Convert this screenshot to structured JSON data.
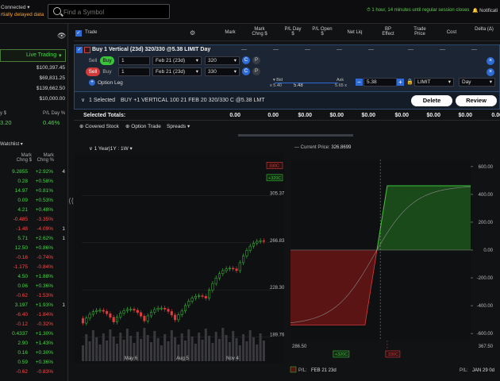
{
  "topbar": {
    "status": "Connected",
    "delayed": "rtially delayed data",
    "search_placeholder": "Find a Symbol",
    "session": "1 hour, 14 minutes until regular session closes",
    "notifications": "Notificati"
  },
  "left": {
    "live_trading": "Live Trading",
    "balances": [
      "$100,397.45",
      "$69,831.25",
      "$139,662.50",
      "$10,000.00"
    ],
    "pl_day_label": "y $",
    "pl_day_value": "3.20",
    "pl_pct_label": "P/L Day %",
    "pl_pct_value": "0.46%",
    "watchlist_label": "Watchlist",
    "col1": "Mark Chng $",
    "col2": "Mark Chng %",
    "rows": [
      {
        "a": "9.2855",
        "b": "+2.92%",
        "c": "green",
        "extra": "4"
      },
      {
        "a": "0.28",
        "b": "+0.58%",
        "c": "green"
      },
      {
        "a": "14.97",
        "b": "+0.81%",
        "c": "green"
      },
      {
        "a": "0.09",
        "b": "+0.53%",
        "c": "green"
      },
      {
        "a": "4.21",
        "b": "+0.48%",
        "c": "green"
      },
      {
        "a": "-0.485",
        "b": "-3.35%",
        "c": "red"
      },
      {
        "a": "-1.48",
        "b": "-4.09%",
        "c": "red",
        "extra": "1"
      },
      {
        "a": "5.71",
        "b": "+2.62%",
        "c": "green",
        "extra": "1"
      },
      {
        "a": "12.50",
        "b": "+0.86%",
        "c": "green"
      },
      {
        "a": "-0.16",
        "b": "-0.74%",
        "c": "red"
      },
      {
        "a": "-1.175",
        "b": "-0.84%",
        "c": "red"
      },
      {
        "a": "4.50",
        "b": "+1.88%",
        "c": "green"
      },
      {
        "a": "0.06",
        "b": "+0.36%",
        "c": "green"
      },
      {
        "a": "-0.62",
        "b": "-1.53%",
        "c": "red"
      },
      {
        "a": "3.197",
        "b": "+1.93%",
        "c": "green",
        "extra": "1"
      },
      {
        "a": "-6.40",
        "b": "-1.84%",
        "c": "red"
      },
      {
        "a": "-0.12",
        "b": "-0.32%",
        "c": "red"
      },
      {
        "a": "0.4337",
        "b": "+1.30%",
        "c": "green"
      },
      {
        "a": "2.90",
        "b": "+1.43%",
        "c": "green"
      },
      {
        "a": "0.16",
        "b": "+0.30%",
        "c": "green"
      },
      {
        "a": "0.59",
        "b": "+0.36%",
        "c": "green"
      },
      {
        "a": "-0.62",
        "b": "-0.83%",
        "c": "red"
      }
    ]
  },
  "table": {
    "headers": [
      "Trade",
      "Mark",
      "Mark Chng $",
      "P/L Day $",
      "P/L Open $",
      "Net Liq",
      "BP Effect",
      "Trade Price",
      "Cost",
      "Delta (Δ)"
    ],
    "order_title": "Buy 1 Vertical (23d) 320/330 @5.38 LIMIT Day",
    "legs": [
      {
        "sell": "Sell",
        "buy": "Buy",
        "active": "buy",
        "qty": "1",
        "exp": "Feb 21 (23d)",
        "strike": "320"
      },
      {
        "sell": "Sell",
        "buy": "Buy",
        "active": "sell",
        "qty": "1",
        "exp": "Feb 21 (23d)",
        "strike": "330"
      }
    ],
    "call_label": "C",
    "put_label": "P",
    "option_leg": "Option Leg",
    "bid_label": "Bid",
    "bid_value": "x 5.40",
    "mid_value": "5.48",
    "ask_label": "Ask",
    "ask_value": "5.65 x",
    "price": "5.38",
    "order_type": "LIMIT",
    "tif": "Day",
    "selected_count": "1 Selected",
    "selected_desc": "BUY +1 VERTICAL 100 21 FEB 20 320/330 C @5.38 LMT",
    "delete": "Delete",
    "review": "Review",
    "totals_label": "Selected Totals:",
    "totals": [
      "0.00",
      "0.00",
      "$0.00",
      "$0.00",
      "$0.00",
      "$0.00",
      "$0.00",
      "$0.00",
      "0.00"
    ],
    "covered_stock": "Covered Stock",
    "option_trade": "Option Trade",
    "spreads": "Spreads"
  },
  "chart_data": [
    {
      "type": "candlestick",
      "period": "1 Year|1Y : 1W",
      "x_ticks": [
        "May 6",
        "Aug 5",
        "Nov 4"
      ],
      "y_ticks": [
        305.37,
        266.83,
        228.3,
        189.76
      ],
      "markers": [
        "330C",
        "+320C"
      ],
      "ylim": [
        170,
        340
      ]
    },
    {
      "type": "line",
      "current_price_label": "Current Price:",
      "current_price": "326.8699",
      "x_ticks": [
        "286.50",
        "367.50"
      ],
      "markers": [
        "+320C",
        "330C"
      ],
      "y_ticks": [
        "600.00",
        "400.00",
        "200.00",
        "0.00",
        "-200.00",
        "-400.00",
        "-600.00"
      ],
      "ylim": [
        -650,
        650
      ],
      "xlim": [
        286.5,
        367.5
      ],
      "expiry_pl": {
        "x": [
          286.5,
          320,
          330,
          367.5
        ],
        "y": [
          -538,
          -538,
          462,
          462
        ]
      },
      "legend_pl": "P/L:",
      "legend_expiry": "FEB 21 23d",
      "legend_right": "P/L:",
      "legend_right_date": "JAN 29 0d",
      "colors": {
        "profit": "#3ac43a",
        "loss": "#d03a3a"
      }
    }
  ]
}
